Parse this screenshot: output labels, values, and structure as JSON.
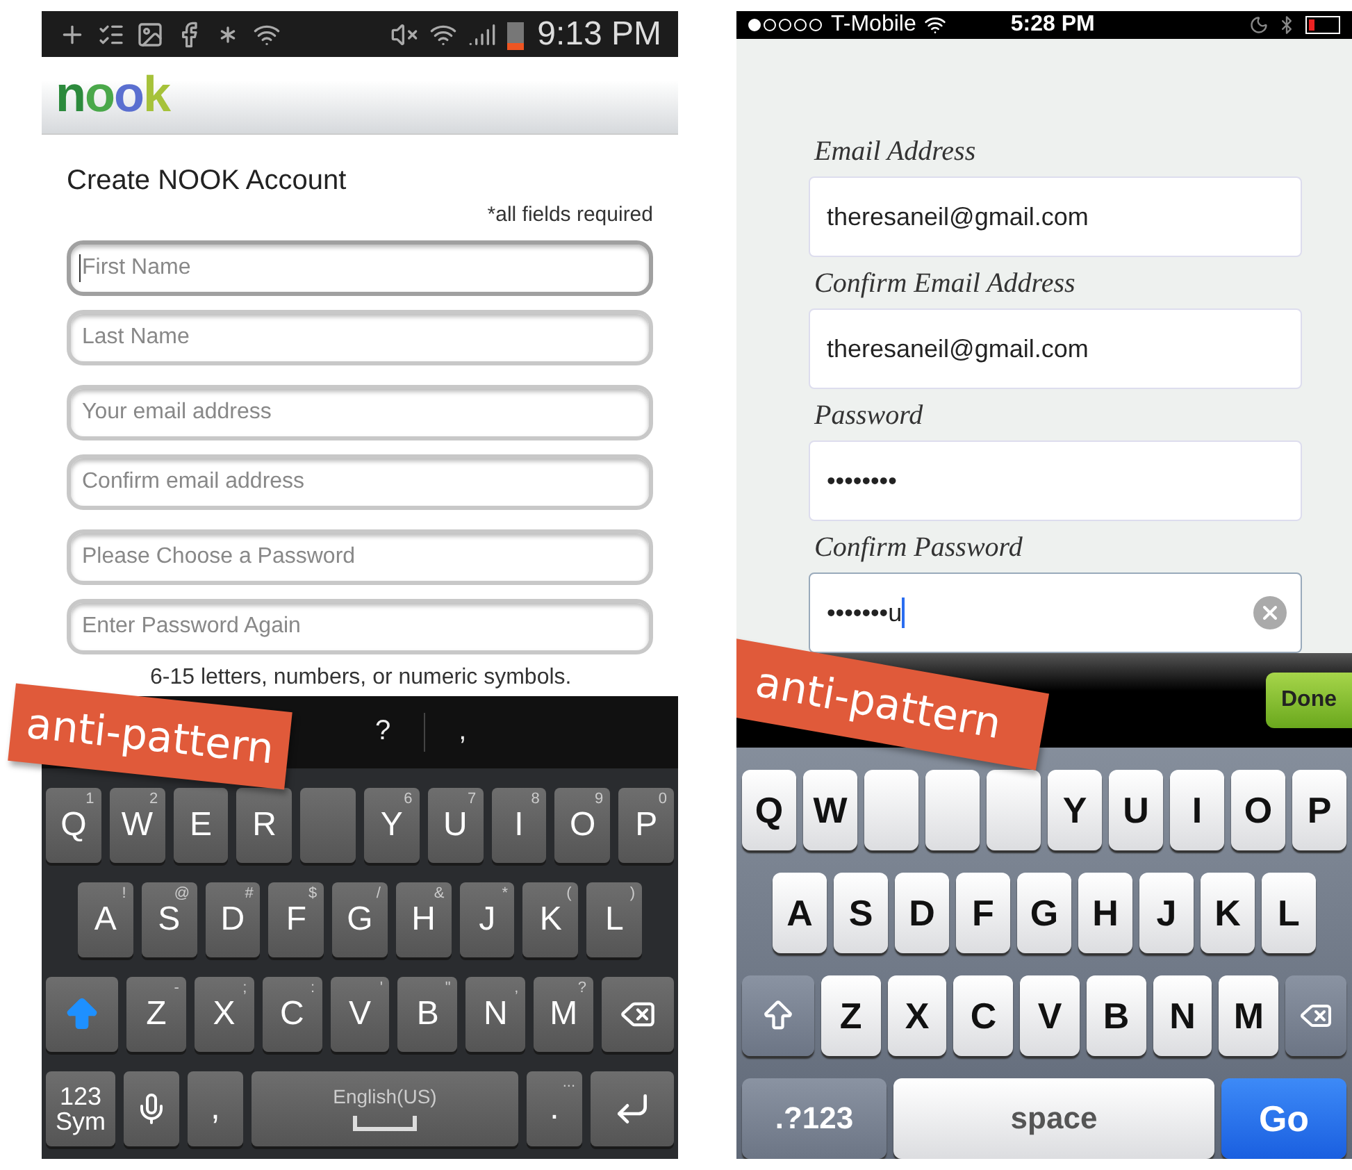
{
  "left_phone": {
    "status_bar": {
      "time": "9:13 PM"
    },
    "logo": "nook",
    "title": "Create NOOK Account",
    "required_note": "*all fields required",
    "fields": [
      {
        "placeholder": "First Name",
        "focused": true
      },
      {
        "placeholder": "Last Name",
        "focused": false
      },
      {
        "placeholder": "Your email address",
        "focused": false
      },
      {
        "placeholder": "Confirm email address",
        "focused": false
      },
      {
        "placeholder": "Please Choose a Password",
        "focused": false
      },
      {
        "placeholder": "Enter Password Again",
        "focused": false
      }
    ],
    "hint": "6-15 letters, numbers, or numeric symbols.",
    "ribbon": "anti-pattern",
    "keyboard": {
      "suggestions": [
        "?",
        ","
      ],
      "rows": [
        [
          {
            "kind": "letter",
            "label": "Q",
            "hint": "1"
          },
          {
            "kind": "letter",
            "label": "W",
            "hint": "2"
          },
          {
            "kind": "letter",
            "label": "E"
          },
          {
            "kind": "letter",
            "label": "R"
          },
          {
            "kind": "covered"
          },
          {
            "kind": "letter",
            "label": "Y",
            "hint": "6"
          },
          {
            "kind": "letter",
            "label": "U",
            "hint": "7"
          },
          {
            "kind": "letter",
            "label": "I",
            "hint": "8"
          },
          {
            "kind": "letter",
            "label": "O",
            "hint": "9"
          },
          {
            "kind": "letter",
            "label": "P",
            "hint": "0"
          }
        ],
        [
          {
            "kind": "letter",
            "label": "A",
            "hint": "!"
          },
          {
            "kind": "letter",
            "label": "S",
            "hint": "@"
          },
          {
            "kind": "letter",
            "label": "D",
            "hint": "#"
          },
          {
            "kind": "letter",
            "label": "F",
            "hint": "$"
          },
          {
            "kind": "letter",
            "label": "G",
            "hint": "/"
          },
          {
            "kind": "letter",
            "label": "H",
            "hint": "&"
          },
          {
            "kind": "letter",
            "label": "J",
            "hint": "*"
          },
          {
            "kind": "letter",
            "label": "K",
            "hint": "("
          },
          {
            "kind": "letter",
            "label": "L",
            "hint": ")"
          }
        ],
        [
          {
            "kind": "shift"
          },
          {
            "kind": "letter",
            "label": "Z",
            "hint": "-"
          },
          {
            "kind": "letter",
            "label": "X",
            "hint": ";"
          },
          {
            "kind": "letter",
            "label": "C",
            "hint": ":"
          },
          {
            "kind": "letter",
            "label": "V",
            "hint": "'"
          },
          {
            "kind": "letter",
            "label": "B",
            "hint": "\""
          },
          {
            "kind": "letter",
            "label": "N",
            "hint": ","
          },
          {
            "kind": "letter",
            "label": "M",
            "hint": "?"
          },
          {
            "kind": "backspace"
          }
        ]
      ],
      "bottom_row": [
        {
          "kind": "sym",
          "label": "123",
          "sub": "Sym"
        },
        {
          "kind": "mic"
        },
        {
          "kind": "letter",
          "label": ","
        },
        {
          "kind": "space",
          "label": "English(US)"
        },
        {
          "kind": "letter",
          "label": ".",
          "hint": "..."
        },
        {
          "kind": "enter"
        }
      ]
    }
  },
  "right_phone": {
    "status_bar": {
      "carrier": "T-Mobile",
      "time": "5:28 PM"
    },
    "fields": [
      {
        "label": "Email Address",
        "value": "theresaneil@gmail.com",
        "focused": false
      },
      {
        "label": "Confirm Email Address",
        "value": "theresaneil@gmail.com",
        "focused": false
      },
      {
        "label": "Password",
        "value": "••••••••",
        "focused": false
      },
      {
        "label": "Confirm Password",
        "value": "•••••••u",
        "focused": true
      }
    ],
    "ribbon": "anti-pattern",
    "keyboard": {
      "done": "Done",
      "rows": [
        [
          {
            "kind": "letter",
            "label": "Q"
          },
          {
            "kind": "letter",
            "label": "W"
          },
          {
            "kind": "covered"
          },
          {
            "kind": "covered"
          },
          {
            "kind": "covered"
          },
          {
            "kind": "letter",
            "label": "Y"
          },
          {
            "kind": "letter",
            "label": "U"
          },
          {
            "kind": "letter",
            "label": "I"
          },
          {
            "kind": "letter",
            "label": "O"
          },
          {
            "kind": "letter",
            "label": "P"
          }
        ],
        [
          {
            "kind": "letter",
            "label": "A"
          },
          {
            "kind": "letter",
            "label": "S"
          },
          {
            "kind": "letter",
            "label": "D"
          },
          {
            "kind": "letter",
            "label": "F"
          },
          {
            "kind": "letter",
            "label": "G"
          },
          {
            "kind": "letter",
            "label": "H"
          },
          {
            "kind": "letter",
            "label": "J"
          },
          {
            "kind": "letter",
            "label": "K"
          },
          {
            "kind": "letter",
            "label": "L"
          }
        ],
        [
          {
            "kind": "shift"
          },
          {
            "kind": "letter",
            "label": "Z"
          },
          {
            "kind": "letter",
            "label": "X"
          },
          {
            "kind": "letter",
            "label": "C"
          },
          {
            "kind": "letter",
            "label": "V"
          },
          {
            "kind": "letter",
            "label": "B"
          },
          {
            "kind": "letter",
            "label": "N"
          },
          {
            "kind": "letter",
            "label": "M"
          },
          {
            "kind": "backspace"
          }
        ]
      ],
      "bottom_row": [
        {
          "kind": "sym",
          "label": ".?123"
        },
        {
          "kind": "space",
          "label": "space"
        },
        {
          "kind": "go",
          "label": "Go"
        }
      ]
    }
  }
}
